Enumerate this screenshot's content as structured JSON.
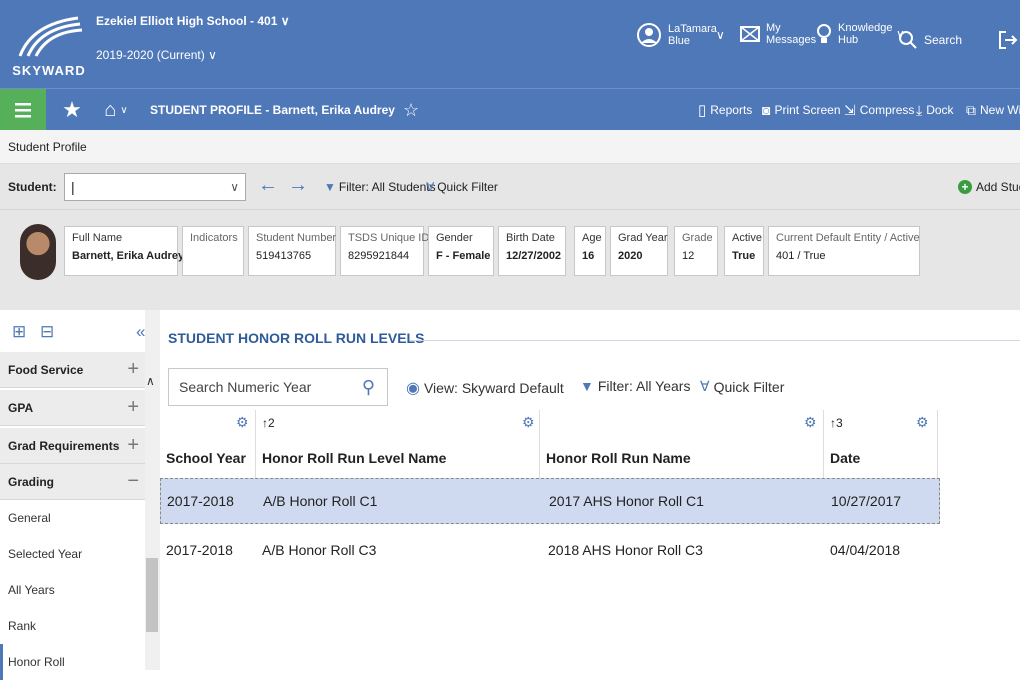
{
  "app": {
    "logo_text": "SKYWARD",
    "school": "Ezekiel Elliott High School - 401",
    "year": "2019-2020 (Current)"
  },
  "topbar": {
    "user_label": "LaTamara Blue",
    "messages_label": "My Messages",
    "knowledge_label": "Knowledge Hub",
    "search_label": "Search"
  },
  "subbar": {
    "profile_title": "STUDENT PROFILE - Barnett, Erika Audrey",
    "tools": [
      "Reports",
      "Print Screen",
      "Compress",
      "Dock",
      "New Wi"
    ]
  },
  "breadcrumb": "Student Profile",
  "student_bar": {
    "label": "Student:",
    "input_value": "",
    "filter_label": "Filter: All Students",
    "quick_filter_label": "Quick Filter",
    "add_label": "Add Studer"
  },
  "info_cards": [
    {
      "header": "Full Name",
      "value": "Barnett, Erika Audrey"
    },
    {
      "header": "Indicators",
      "value": ""
    },
    {
      "header": "Student Number",
      "value": "519413765"
    },
    {
      "header": "TSDS Unique ID",
      "value": "8295921844"
    },
    {
      "header": "Gender",
      "value": "F - Female"
    },
    {
      "header": "Birth Date",
      "value": "12/27/2002"
    },
    {
      "header": "Age",
      "value": "16"
    },
    {
      "header": "Grad Year",
      "value": "2020"
    },
    {
      "header": "Grade",
      "value": "12"
    },
    {
      "header": "Active",
      "value": "True"
    },
    {
      "header": "Current Default Entity / Active",
      "value": "401 / True"
    }
  ],
  "sidebar": {
    "groups": [
      {
        "label": "Food Service",
        "toggle": "+"
      },
      {
        "label": "GPA",
        "toggle": "+"
      },
      {
        "label": "Grad Requirements",
        "toggle": "+"
      },
      {
        "label": "Grading",
        "toggle": "−"
      }
    ],
    "subitems": [
      "General",
      "Selected Year",
      "All Years",
      "Rank",
      "Honor Roll"
    ]
  },
  "main": {
    "section_title": "STUDENT HONOR ROLL RUN LEVELS",
    "search_placeholder": "Search Numeric Year",
    "view_label": "View: Skyward Default",
    "filter_label": "Filter: All Years",
    "quick_filter_label": "Quick Filter",
    "columns": [
      {
        "label": "School Year",
        "sort": ""
      },
      {
        "label": "Honor Roll Run Level Name",
        "sort": "↑2"
      },
      {
        "label": "Honor Roll Run Name",
        "sort": ""
      },
      {
        "label": "Date",
        "sort": "↑3"
      }
    ],
    "rows": [
      [
        "2017-2018",
        "A/B Honor Roll C1",
        "2017 AHS Honor Roll C1",
        "10/27/2017"
      ],
      [
        "2017-2018",
        "A/B Honor Roll C3",
        "2018 AHS Honor Roll C3",
        "04/04/2018"
      ]
    ]
  },
  "colors": {
    "brand": "#4f78b8",
    "menu_green": "#56b05a",
    "selected_row": "#cfdaf0"
  }
}
